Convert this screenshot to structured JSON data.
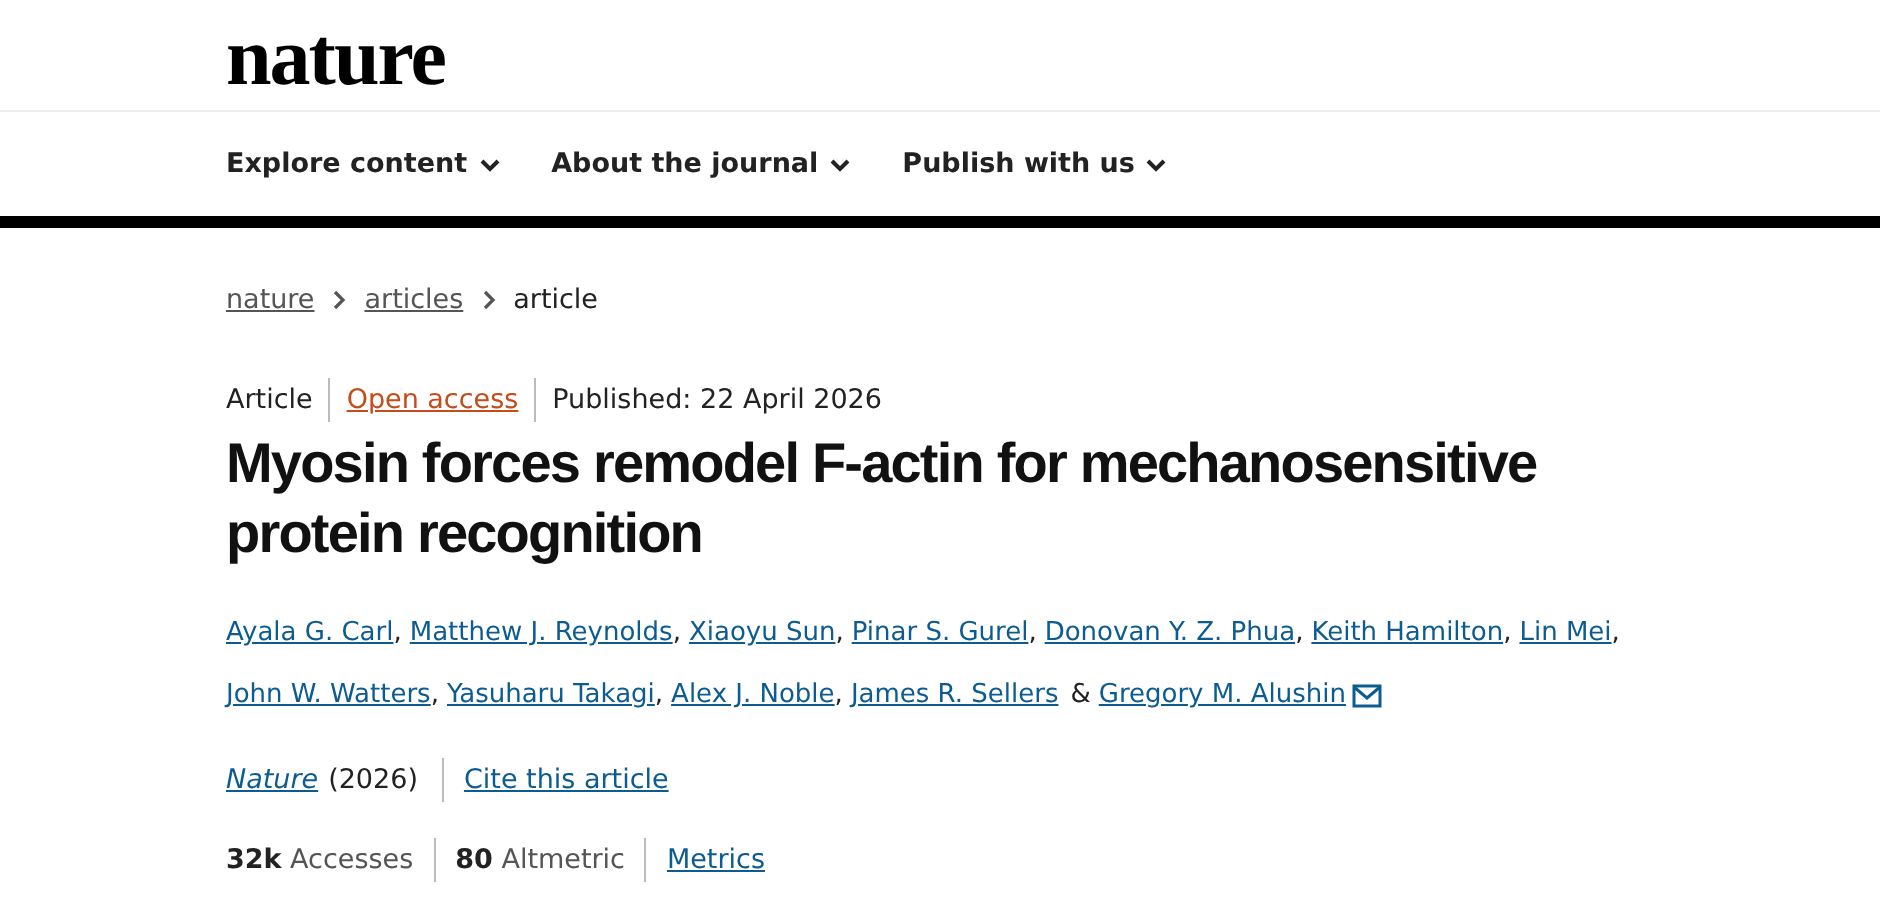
{
  "logo": "nature",
  "nav": [
    {
      "label": "Explore content"
    },
    {
      "label": "About the journal"
    },
    {
      "label": "Publish with us"
    }
  ],
  "breadcrumb": [
    {
      "label": "nature",
      "link": true
    },
    {
      "label": "articles",
      "link": true
    },
    {
      "label": "article",
      "link": false
    }
  ],
  "meta": {
    "type": "Article",
    "access": "Open access",
    "published": "Published: 22 April 2026"
  },
  "title": "Myosin forces remodel F-actin for mechanosensitive protein recognition",
  "authors": [
    {
      "name": "Ayala G. Carl",
      "sep": ","
    },
    {
      "name": "Matthew J. Reynolds",
      "sep": ","
    },
    {
      "name": "Xiaoyu Sun",
      "sep": ","
    },
    {
      "name": "Pinar S. Gurel",
      "sep": ","
    },
    {
      "name": "Donovan Y. Z. Phua",
      "sep": ","
    },
    {
      "name": "Keith Hamilton",
      "sep": ","
    },
    {
      "name": "Lin Mei",
      "sep": ","
    },
    {
      "name": "John W. Watters",
      "sep": ","
    },
    {
      "name": "Yasuharu Takagi",
      "sep": ","
    },
    {
      "name": "Alex J. Noble",
      "sep": ","
    },
    {
      "name": "James R. Sellers",
      "sep": "&"
    },
    {
      "name": "Gregory M. Alushin",
      "email": true
    }
  ],
  "citation": {
    "journal": "Nature",
    "year": "(2026)",
    "cite": "Cite this article"
  },
  "metrics": [
    "**32k** Accesses",
    "**80** Altmetric"
  ],
  "metrics_link": "Metrics"
}
